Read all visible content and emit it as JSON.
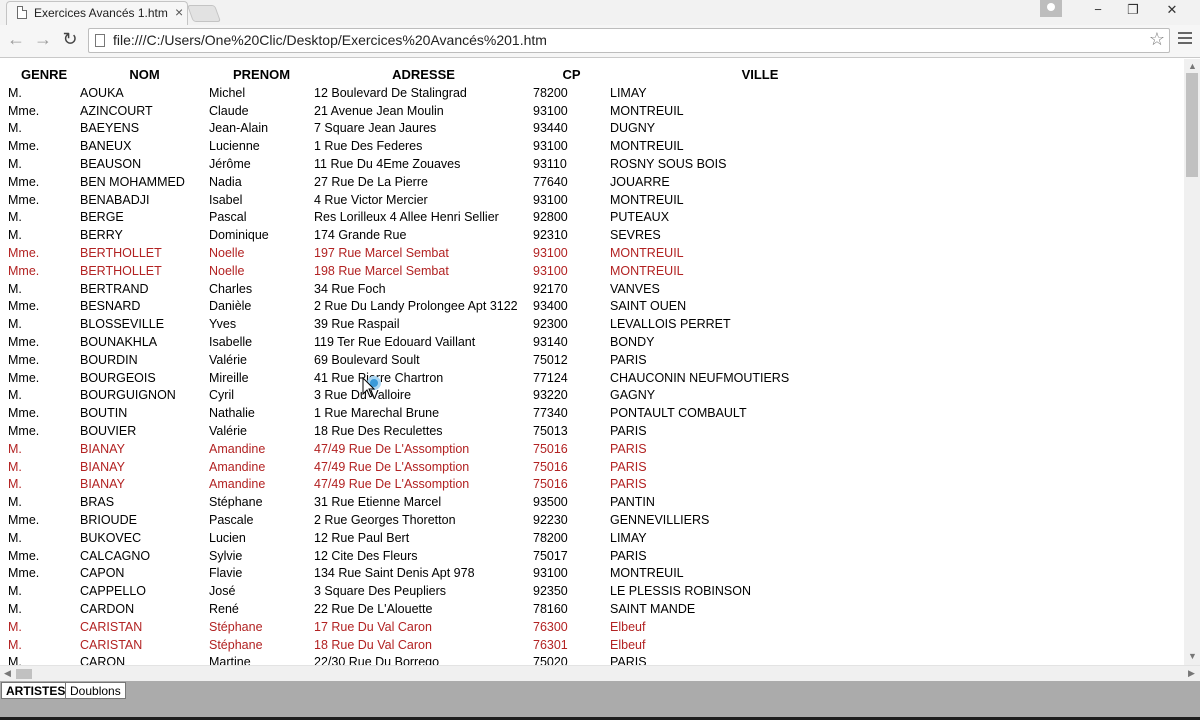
{
  "browser": {
    "tab_title": "Exercices Avancés 1.htm",
    "tab_close": "×",
    "url": "file:///C:/Users/One%20Clic/Desktop/Exercices%20Avancés%201.htm",
    "back_icon": "←",
    "forward_icon": "→",
    "reload_icon": "↻",
    "star_icon": "☆",
    "min_icon": "−",
    "max_icon": "❐",
    "close_icon": "✕"
  },
  "table": {
    "headers": {
      "genre": "GENRE",
      "nom": "NOM",
      "prenom": "PRENOM",
      "adresse": "ADRESSE",
      "cp": "CP",
      "ville": "VILLE"
    },
    "rows": [
      {
        "genre": "M.",
        "nom": "AOUKA",
        "prenom": "Michel",
        "adresse": "12 Boulevard De Stalingrad",
        "cp": "78200",
        "ville": "LIMAY",
        "dup": false
      },
      {
        "genre": "Mme.",
        "nom": "AZINCOURT",
        "prenom": "Claude",
        "adresse": "21 Avenue Jean Moulin",
        "cp": "93100",
        "ville": "MONTREUIL",
        "dup": false
      },
      {
        "genre": "M.",
        "nom": "BAEYENS",
        "prenom": "Jean-Alain",
        "adresse": "7 Square Jean Jaures",
        "cp": "93440",
        "ville": "DUGNY",
        "dup": false
      },
      {
        "genre": "Mme.",
        "nom": "BANEUX",
        "prenom": "Lucienne",
        "adresse": "1 Rue Des Federes",
        "cp": "93100",
        "ville": "MONTREUIL",
        "dup": false
      },
      {
        "genre": "M.",
        "nom": "BEAUSON",
        "prenom": "Jérôme",
        "adresse": "11 Rue Du 4Eme Zouaves",
        "cp": "93110",
        "ville": "ROSNY SOUS BOIS",
        "dup": false
      },
      {
        "genre": "Mme.",
        "nom": "BEN MOHAMMED",
        "prenom": "Nadia",
        "adresse": "27 Rue De La Pierre",
        "cp": "77640",
        "ville": "JOUARRE",
        "dup": false
      },
      {
        "genre": "Mme.",
        "nom": "BENABADJI",
        "prenom": "Isabel",
        "adresse": "4 Rue Victor Mercier",
        "cp": "93100",
        "ville": "MONTREUIL",
        "dup": false
      },
      {
        "genre": "M.",
        "nom": "BERGE",
        "prenom": "Pascal",
        "adresse": "Res Lorilleux 4 Allee Henri Sellier",
        "cp": "92800",
        "ville": "PUTEAUX",
        "dup": false
      },
      {
        "genre": "M.",
        "nom": "BERRY",
        "prenom": "Dominique",
        "adresse": "174 Grande Rue",
        "cp": "92310",
        "ville": "SEVRES",
        "dup": false
      },
      {
        "genre": "Mme.",
        "nom": "BERTHOLLET",
        "prenom": "Noelle",
        "adresse": "197 Rue Marcel Sembat",
        "cp": "93100",
        "ville": "MONTREUIL",
        "dup": true
      },
      {
        "genre": "Mme.",
        "nom": "BERTHOLLET",
        "prenom": "Noelle",
        "adresse": "198 Rue Marcel Sembat",
        "cp": "93100",
        "ville": "MONTREUIL",
        "dup": true
      },
      {
        "genre": "M.",
        "nom": "BERTRAND",
        "prenom": "Charles",
        "adresse": "34 Rue Foch",
        "cp": "92170",
        "ville": "VANVES",
        "dup": false
      },
      {
        "genre": "Mme.",
        "nom": "BESNARD",
        "prenom": "Danièle",
        "adresse": "2 Rue Du Landy Prolongee Apt 3122",
        "cp": "93400",
        "ville": "SAINT OUEN",
        "dup": false
      },
      {
        "genre": "M.",
        "nom": "BLOSSEVILLE",
        "prenom": "Yves",
        "adresse": "39 Rue Raspail",
        "cp": "92300",
        "ville": "LEVALLOIS PERRET",
        "dup": false
      },
      {
        "genre": "Mme.",
        "nom": "BOUNAKHLA",
        "prenom": "Isabelle",
        "adresse": "119 Ter Rue Edouard Vaillant",
        "cp": "93140",
        "ville": "BONDY",
        "dup": false
      },
      {
        "genre": "Mme.",
        "nom": "BOURDIN",
        "prenom": "Valérie",
        "adresse": "69 Boulevard Soult",
        "cp": "75012",
        "ville": "PARIS",
        "dup": false
      },
      {
        "genre": "Mme.",
        "nom": "BOURGEOIS",
        "prenom": "Mireille",
        "adresse": "41 Rue Pierre Chartron",
        "cp": "77124",
        "ville": "CHAUCONIN NEUFMOUTIERS",
        "dup": false
      },
      {
        "genre": "M.",
        "nom": "BOURGUIGNON",
        "prenom": "Cyril",
        "adresse": "3 Rue Du Valloire",
        "cp": "93220",
        "ville": "GAGNY",
        "dup": false
      },
      {
        "genre": "Mme.",
        "nom": "BOUTIN",
        "prenom": "Nathalie",
        "adresse": "1 Rue Marechal Brune",
        "cp": "77340",
        "ville": "PONTAULT COMBAULT",
        "dup": false
      },
      {
        "genre": "Mme.",
        "nom": "BOUVIER",
        "prenom": "Valérie",
        "adresse": "18 Rue Des Reculettes",
        "cp": "75013",
        "ville": "PARIS",
        "dup": false
      },
      {
        "genre": "M.",
        "nom": "BIANAY",
        "prenom": "Amandine",
        "adresse": "47/49 Rue De L'Assomption",
        "cp": "75016",
        "ville": "PARIS",
        "dup": true
      },
      {
        "genre": "M.",
        "nom": "BIANAY",
        "prenom": "Amandine",
        "adresse": "47/49 Rue De L'Assomption",
        "cp": "75016",
        "ville": "PARIS",
        "dup": true
      },
      {
        "genre": "M.",
        "nom": "BIANAY",
        "prenom": "Amandine",
        "adresse": "47/49 Rue De L'Assomption",
        "cp": "75016",
        "ville": "PARIS",
        "dup": true
      },
      {
        "genre": "M.",
        "nom": "BRAS",
        "prenom": "Stéphane",
        "adresse": "31 Rue Etienne Marcel",
        "cp": "93500",
        "ville": "PANTIN",
        "dup": false
      },
      {
        "genre": "Mme.",
        "nom": "BRIOUDE",
        "prenom": "Pascale",
        "adresse": "2 Rue Georges Thoretton",
        "cp": "92230",
        "ville": "GENNEVILLIERS",
        "dup": false
      },
      {
        "genre": "M.",
        "nom": "BUKOVEC",
        "prenom": "Lucien",
        "adresse": "12 Rue Paul Bert",
        "cp": "78200",
        "ville": "LIMAY",
        "dup": false
      },
      {
        "genre": "Mme.",
        "nom": "CALCAGNO",
        "prenom": "Sylvie",
        "adresse": "12 Cite Des Fleurs",
        "cp": "75017",
        "ville": "PARIS",
        "dup": false
      },
      {
        "genre": "Mme.",
        "nom": "CAPON",
        "prenom": "Flavie",
        "adresse": "134 Rue Saint Denis Apt 978",
        "cp": "93100",
        "ville": "MONTREUIL",
        "dup": false
      },
      {
        "genre": "M.",
        "nom": "CAPPELLO",
        "prenom": "José",
        "adresse": "3 Square Des Peupliers",
        "cp": "92350",
        "ville": "LE PLESSIS ROBINSON",
        "dup": false
      },
      {
        "genre": "M.",
        "nom": "CARDON",
        "prenom": "René",
        "adresse": "22 Rue De L'Alouette",
        "cp": "78160",
        "ville": "SAINT MANDE",
        "dup": false
      },
      {
        "genre": "M.",
        "nom": "CARISTAN",
        "prenom": "Stéphane",
        "adresse": "17 Rue Du Val Caron",
        "cp": "76300",
        "ville": "Elbeuf",
        "dup": true
      },
      {
        "genre": "M.",
        "nom": "CARISTAN",
        "prenom": "Stéphane",
        "adresse": "18 Rue Du Val Caron",
        "cp": "76301",
        "ville": "Elbeuf",
        "dup": true
      },
      {
        "genre": "M.",
        "nom": "CARON",
        "prenom": "Martine",
        "adresse": "22/30 Rue Du Borrego",
        "cp": "75020",
        "ville": "PARIS",
        "dup": false
      }
    ]
  },
  "sheet_tabs": [
    {
      "label": "ARTISTES",
      "active": true
    },
    {
      "label": "Doublons",
      "active": false
    }
  ],
  "colors": {
    "duplicate_text": "#b22222",
    "normal_text": "#000000"
  }
}
